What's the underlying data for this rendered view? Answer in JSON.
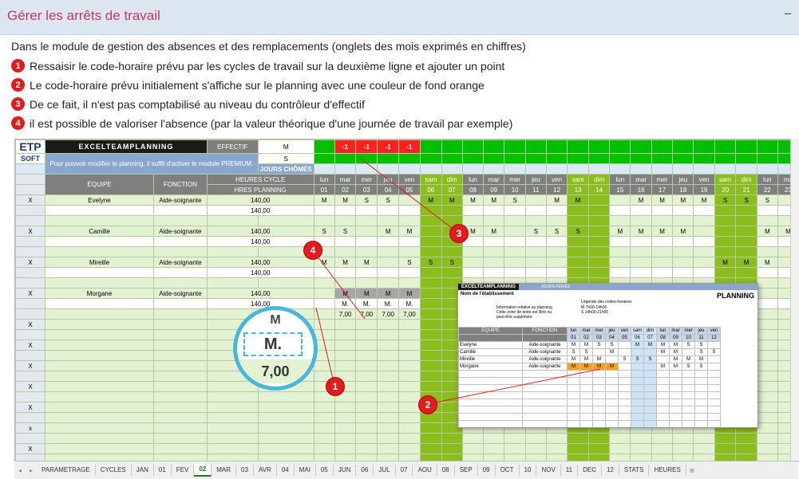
{
  "header": {
    "title": "Gérer les arrêts de travail",
    "toggle": "−"
  },
  "intro": "Dans le module de gestion des absences et des remplacements (onglets des mois exprimés en chiffres)",
  "steps": [
    {
      "num": "1",
      "text": "Ressaisir le code-horaire prévu par les cycles de travail sur la deuxième ligne et ajouter un point"
    },
    {
      "num": "2",
      "text": "Le code-horaire prévu initialement s'affiche sur le planning avec une couleur de fond orange"
    },
    {
      "num": "3",
      "text": "De ce fait, il n'est pas comptabilisé au niveau du contrôleur d'effectif"
    },
    {
      "num": "4",
      "text": "il est possible de valoriser l'absence (par la valeur théorique d'une journée de travail par exemple)"
    }
  ],
  "sheet": {
    "logo_top": "ETP",
    "logo_bottom": "SOFT",
    "brand": "EXCELTEAMPLANNING",
    "effectif": "EFFECTIF",
    "message": "Pour pouvoir modifier le planning, il suffit d'activer le module PREMIUM.",
    "effectif_rows": [
      "M",
      "S"
    ],
    "jours_chomes": "JOURS CHÔMÉS",
    "col_equipe": "ÉQUIPE",
    "col_fonction": "FONCTION",
    "col_heures_cycle": "HEURES CYCLE",
    "col_hres_planning": "HRES PLANNING",
    "day_names": [
      "lun",
      "mar",
      "mer",
      "jeu",
      "ven",
      "sam",
      "dim",
      "lun",
      "mar",
      "mer",
      "jeu",
      "ven",
      "sam",
      "dim",
      "lun",
      "mar",
      "mer",
      "jeu",
      "ven",
      "sam",
      "dim",
      "lun",
      "ma"
    ],
    "day_nums": [
      "01",
      "02",
      "03",
      "04",
      "05",
      "06",
      "07",
      "08",
      "09",
      "10",
      "11",
      "12",
      "13",
      "14",
      "15",
      "16",
      "17",
      "18",
      "19",
      "20",
      "21",
      "22",
      "23"
    ],
    "minus_one": "-1",
    "employees": [
      {
        "x": "X",
        "name": "Evelyne",
        "role": "Aide-soignante",
        "h1": "140,00",
        "h2": "140,00",
        "codes": [
          "M",
          "M",
          "S",
          "S",
          "",
          "M",
          "M",
          "M",
          "M",
          "S",
          "",
          "M",
          "M",
          "",
          "",
          "M",
          "M",
          "M",
          "M",
          "S",
          "S",
          "S",
          "",
          "M",
          "M"
        ]
      },
      {
        "x": "X",
        "name": "Camille",
        "role": "Aide-soignante",
        "h1": "140,00",
        "h2": "140,00",
        "codes": [
          "S",
          "S",
          "",
          "M",
          "M",
          "",
          "",
          "M",
          "M",
          "",
          "S",
          "S",
          "S",
          "",
          "M",
          "M",
          "M",
          "M",
          "",
          "",
          "",
          "M",
          "M"
        ]
      },
      {
        "x": "X",
        "name": "Mireille",
        "role": "Aide-soignante",
        "h1": "140,00",
        "h2": "140,00",
        "codes": [
          "M",
          "M",
          "M",
          "",
          "S",
          "S",
          "S",
          "",
          "",
          "",
          "",
          "",
          "",
          "",
          "",
          "",
          "",
          "",
          "",
          "M",
          "M",
          "M",
          ""
        ]
      },
      {
        "x": "X",
        "name": "Morgane",
        "role": "Aide-soignante",
        "h1": "140,00",
        "h2": "140,00",
        "codes": [
          "",
          "M",
          "M",
          "M",
          "M",
          "",
          "",
          "M",
          "",
          "",
          "",
          "",
          "",
          "",
          "",
          "",
          "",
          "",
          "",
          "",
          "",
          "",
          ""
        ]
      }
    ],
    "morgane_row2": [
      "M.",
      "M.",
      "M.",
      "M."
    ],
    "morgane_row3": [
      "7,00",
      "7,00",
      "7,00",
      "7,00"
    ],
    "blank_x": [
      "X",
      "X",
      "X",
      "X",
      "X",
      "x",
      "X",
      "x"
    ],
    "magnifier_top": "M",
    "magnifier_mid": "M.",
    "magnifier_bottom": "7,00"
  },
  "inset": {
    "brand": "EXCELTEAMPLANNING",
    "jours": "JOURS FÉRIÉS",
    "etab": "Nom de l'établissement",
    "planning": "PLANNING",
    "legend_title": "Légende des codes-horaires",
    "legend": [
      [
        "M",
        "7h00-14h00"
      ],
      [
        "S",
        "14h00-21h00"
      ]
    ],
    "info1": "Information relative au planning",
    "info2": "Cette zone de texte est libre ou peut-être supprimée",
    "col_equipe": "ÉQUIPE",
    "col_fonction": "FONCTION",
    "days": [
      "lun",
      "mar",
      "mer",
      "jeu",
      "ven",
      "sam",
      "dim",
      "lun",
      "mar",
      "mer",
      "jeu",
      "ven"
    ],
    "nums": [
      "01",
      "02",
      "03",
      "04",
      "05",
      "06",
      "07",
      "08",
      "09",
      "10",
      "11",
      "12"
    ],
    "rows": [
      {
        "name": "Evelyne",
        "role": "Aide-soignante",
        "codes": [
          "M",
          "M",
          "S",
          "S",
          "",
          "M",
          "M",
          "M",
          "M",
          "S",
          "S",
          ""
        ]
      },
      {
        "name": "Camille",
        "role": "Aide-soignante",
        "codes": [
          "S",
          "S",
          "",
          "M",
          "",
          "",
          "",
          "M",
          "M",
          "",
          "S",
          "S"
        ]
      },
      {
        "name": "Mireille",
        "role": "Aide-soignante",
        "codes": [
          "M",
          "M",
          "M",
          "",
          "S",
          "S",
          "S",
          "",
          "M",
          "M",
          "M",
          ""
        ]
      },
      {
        "name": "Morgane",
        "role": "Aide-soignante",
        "codes": [
          "M",
          "M",
          "M",
          "M",
          "",
          "",
          "",
          "M",
          "M",
          "S",
          "S",
          ""
        ]
      }
    ]
  },
  "callouts": [
    "1",
    "2",
    "3",
    "4"
  ],
  "tabs": [
    "PARAMETRAGE",
    "CYCLES",
    "JAN",
    "01",
    "FEV",
    "02",
    "MAR",
    "03",
    "AVR",
    "04",
    "MAI",
    "05",
    "JUN",
    "06",
    "JUL",
    "07",
    "AOU",
    "08",
    "SEP",
    "09",
    "OCT",
    "10",
    "NOV",
    "11",
    "DEC",
    "12",
    "STATS",
    "HEURES"
  ],
  "active_tab": "02",
  "colors": {
    "accent": "#c5365a",
    "weekend": "#8bbd1c",
    "badge": "#e01c1c",
    "orange": "#f7a21b"
  }
}
